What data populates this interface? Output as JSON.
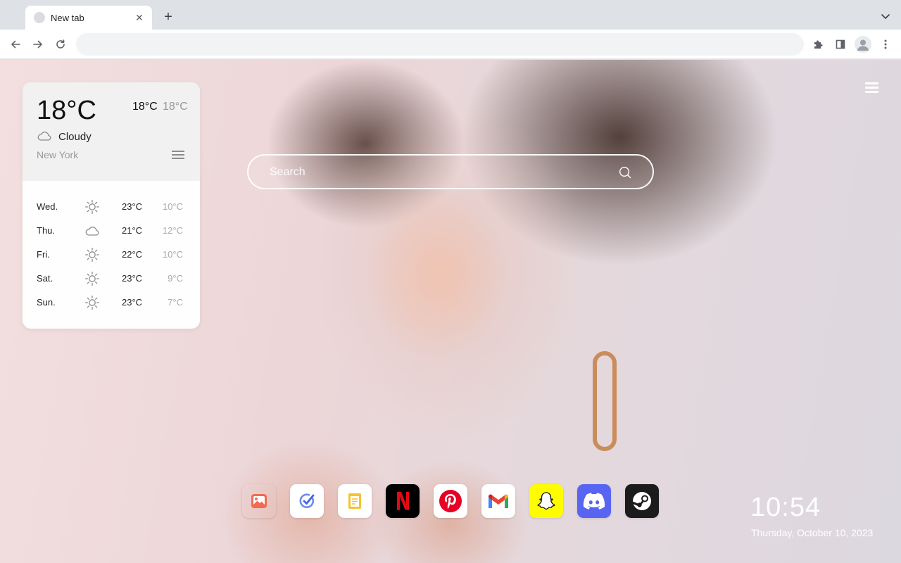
{
  "browser": {
    "tab_title": "New tab",
    "tab_close_glyph": "✕",
    "new_tab_glyph": "+",
    "omnibox_value": "",
    "icons": [
      "back-arrow-icon",
      "forward-arrow-icon",
      "reload-icon",
      "extensions-puzzle-icon",
      "side-panel-icon",
      "profile-avatar-icon",
      "kebab-menu-icon",
      "tab-search-chevron-icon"
    ]
  },
  "weather": {
    "current_temp": "18°C",
    "high": "18°C",
    "low": "18°C",
    "condition": "Cloudy",
    "city": "New York",
    "forecast": [
      {
        "day": "Wed.",
        "icon": "sun-icon",
        "high": "23°C",
        "low": "10°C"
      },
      {
        "day": "Thu.",
        "icon": "cloud-icon",
        "high": "21°C",
        "low": "12°C"
      },
      {
        "day": "Fri.",
        "icon": "sun-icon",
        "high": "22°C",
        "low": "10°C"
      },
      {
        "day": "Sat.",
        "icon": "sun-icon",
        "high": "23°C",
        "low": "9°C"
      },
      {
        "day": "Sun.",
        "icon": "sun-icon",
        "high": "23°C",
        "low": "7°C"
      }
    ]
  },
  "search": {
    "placeholder": "Search"
  },
  "apps": [
    {
      "name": "photos-app",
      "icon": "image-icon",
      "color": "#ffffff"
    },
    {
      "name": "tasks-app",
      "icon": "check-circle-icon",
      "color": "#ffffff"
    },
    {
      "name": "notes-app",
      "icon": "notes-icon",
      "color": "#ffffff"
    },
    {
      "name": "netflix-app",
      "icon": "netflix-logo-icon",
      "color": "#000000"
    },
    {
      "name": "pinterest-app",
      "icon": "pinterest-logo-icon",
      "color": "#ffffff"
    },
    {
      "name": "gmail-app",
      "icon": "gmail-logo-icon",
      "color": "#ffffff"
    },
    {
      "name": "snapchat-app",
      "icon": "snapchat-ghost-icon",
      "color": "#fffc00"
    },
    {
      "name": "discord-app",
      "icon": "discord-logo-icon",
      "color": "#5865f2"
    },
    {
      "name": "steam-app",
      "icon": "steam-logo-icon",
      "color": "#1b1b1b"
    }
  ],
  "clock": {
    "time": "10:54",
    "date": "Thursday, October 10, 2023"
  }
}
